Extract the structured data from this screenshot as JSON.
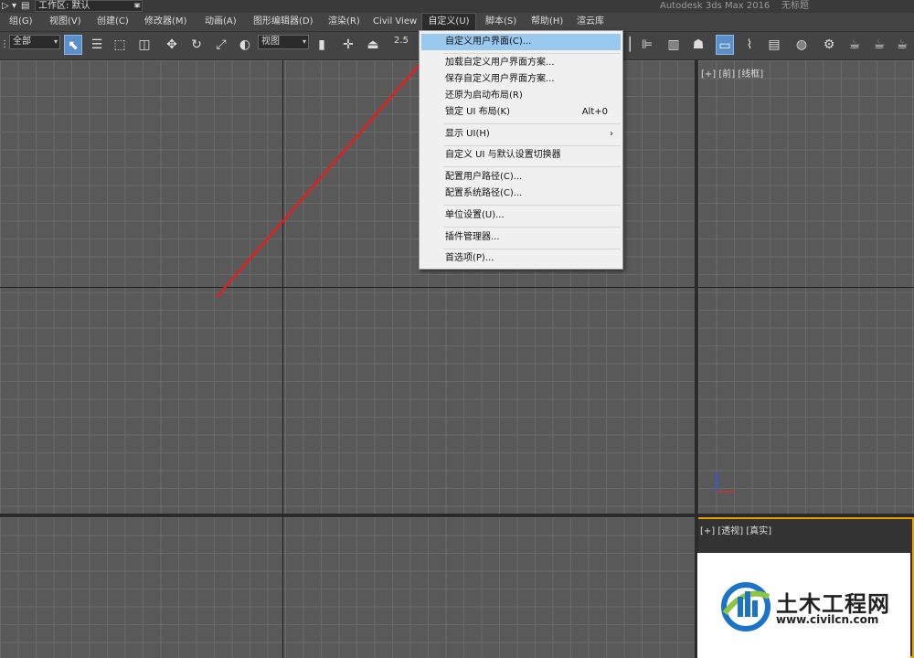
{
  "titlebar": {
    "workspace_label": "工作区: 默认",
    "app_title": "Autodesk 3ds Max 2016",
    "doc_title": "无标题"
  },
  "menubar": [
    {
      "label": "组(G)"
    },
    {
      "label": "视图(V)"
    },
    {
      "label": "创建(C)"
    },
    {
      "label": "修改器(M)"
    },
    {
      "label": "动画(A)"
    },
    {
      "label": "图形编辑器(D)"
    },
    {
      "label": "渲染(R)"
    },
    {
      "label": "Civil View"
    },
    {
      "label": "自定义(U)"
    },
    {
      "label": "脚本(S)"
    },
    {
      "label": "帮助(H)"
    },
    {
      "label": "渲云库"
    }
  ],
  "toolbar": {
    "selection_filter": "全部",
    "reference_coord": "视图",
    "snap_value": "2.5"
  },
  "customize_menu": {
    "items": [
      {
        "label": "自定义用户界面(C)...",
        "highlighted": true
      },
      {
        "label": "加载自定义用户界面方案..."
      },
      {
        "label": "保存自定义用户界面方案..."
      },
      {
        "label": "还原为启动布局(R)"
      },
      {
        "label": "锁定 UI 布局(K)",
        "shortcut": "Alt+0"
      },
      {
        "label": "显示 UI(H)",
        "submenu": true
      },
      {
        "label": "自定义 UI 与默认设置切换器"
      },
      {
        "label": "配置用户路径(C)..."
      },
      {
        "label": "配置系统路径(C)..."
      },
      {
        "label": "单位设置(U)..."
      },
      {
        "label": "插件管理器..."
      },
      {
        "label": "首选项(P)..."
      }
    ]
  },
  "viewports": {
    "front_label": "[+] [前] [线框]",
    "perspective_label": "[+] [透视] [真实]"
  },
  "watermark": {
    "name": "土木工程网",
    "url": "www.civilcn.com"
  },
  "colors": {
    "highlight": "#99c9ef",
    "arrow": "#e02020",
    "viewport_bg": "#595959",
    "active_border": "#e8a000"
  }
}
